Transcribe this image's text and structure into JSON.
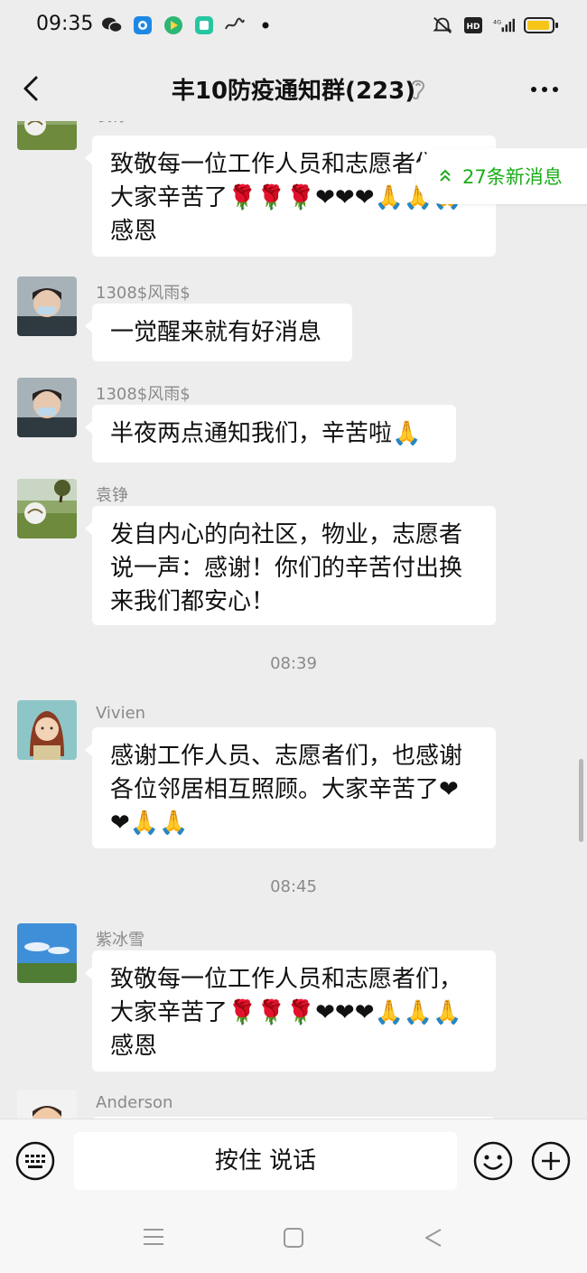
{
  "status": {
    "time": "09:35",
    "network": "4G",
    "hd": "HD"
  },
  "header": {
    "title": "丰10防疫通知群(223)"
  },
  "new_messages": {
    "label": "27条新消息"
  },
  "messages": [
    {
      "sender": "袁铮",
      "text": "致敬每一位工作人员和志愿者们，大家辛苦了🌹🌹🌹❤❤❤🙏🙏🙏 感恩"
    },
    {
      "sender": "1308$风雨$",
      "text": "一觉醒来就有好消息"
    },
    {
      "sender": "1308$风雨$",
      "text": "半夜两点通知我们，辛苦啦🙏"
    },
    {
      "sender": "袁铮",
      "text": "发自内心的向社区，物业，志愿者说一声：感谢！你们的辛苦付出换来我们都安心！"
    },
    {
      "sender": "Vivien",
      "text": "感谢工作人员、志愿者们，也感谢各位邻居相互照顾。大家辛苦了❤❤🙏🙏"
    },
    {
      "sender": "紫冰雪",
      "text": "致敬每一位工作人员和志愿者们，大家辛苦了🌹🌹🌹❤❤❤🙏🙏🙏 感恩"
    },
    {
      "sender": "Anderson",
      "text": ""
    }
  ],
  "timestamps": [
    "08:39",
    "08:45"
  ],
  "input": {
    "talk_label": "按住 说话"
  },
  "colors": {
    "accent": "#1aad19",
    "background": "#ededed",
    "bubble": "#ffffff"
  },
  "icons": {
    "back": "chevron-left-icon",
    "ear": "ear-icon",
    "more": "more-icon",
    "keyboard": "keyboard-icon",
    "emoji": "emoji-icon",
    "plus": "plus-icon"
  }
}
